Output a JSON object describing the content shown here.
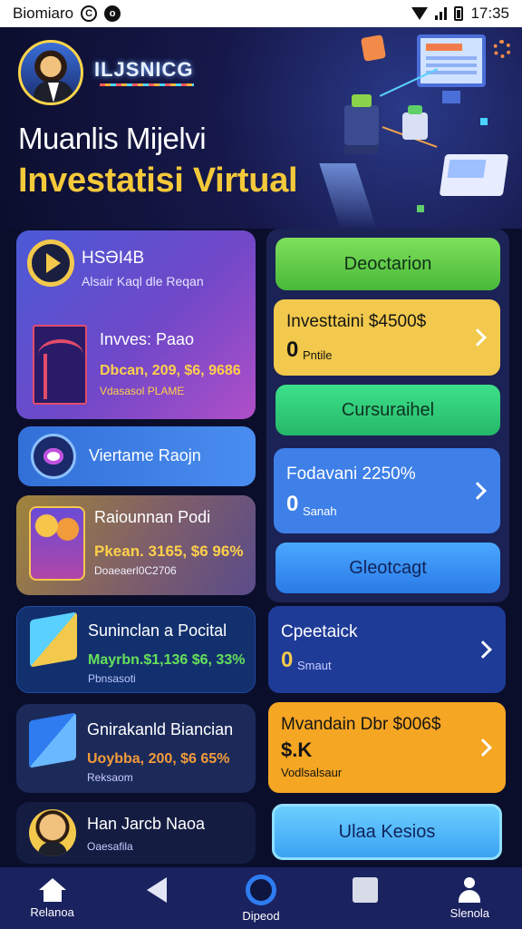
{
  "status_bar": {
    "carrier": "Biomiaro",
    "time": "17:35"
  },
  "hero": {
    "brand": "ILJSNICG",
    "title": "Muanlis Mijelvi",
    "subtitle": "Investatisi Virtual"
  },
  "left_cards": {
    "card1": {
      "title": "HSƏI4B",
      "subtitle": "Alsair Kaql dle Reqan",
      "item_title": "Invves: Paao",
      "item_value": "Dbcan, 209, $6, 9686",
      "item_note": "Vdasasol PLAME"
    },
    "card2": {
      "title": "Viertame Raojn"
    },
    "card3": {
      "title": "Raiounnan Podi",
      "value": "Pkean. 3165, $6 96%",
      "note": "Doaeaerl0C2706"
    },
    "card4": {
      "title": "Suninclan a Pocital",
      "value": "Mayrbn.$1,136 $6, 33%",
      "note": "Pbnsasoti"
    },
    "card5": {
      "title": "Gnirakanld Biancian",
      "value": "Uoybba, 200, $6 65%",
      "note": "Reksaom"
    },
    "card6": {
      "title": "Han Jarcb Naoa",
      "note": "Oaesafila"
    }
  },
  "right_cards": {
    "btn1": "Deoctarion",
    "card2": {
      "title": "Investtaini $4500$",
      "value": "0",
      "note": "Pntile"
    },
    "btn3": "Cursuraihel",
    "card4": {
      "title": "Fodavani 2250%",
      "value": "0",
      "note": "Sanah"
    },
    "btn5": "Gleotcagt",
    "card6": {
      "title": "Cpeetaick",
      "value": "0",
      "note": "Smaut"
    },
    "card7": {
      "title": "Mvandain Dbr $006$",
      "value": "$.K",
      "note": "Vodlsalsaur"
    },
    "btn8": "Ulaa Kesios"
  },
  "nav": {
    "home": "Relanoa",
    "center": "Dipeod",
    "profile": "Slenola"
  },
  "colors": {
    "background": "#0b0e2a",
    "accent_yellow": "#f2c94c",
    "accent_green": "#49b83a",
    "accent_blue": "#2f7cf0"
  }
}
